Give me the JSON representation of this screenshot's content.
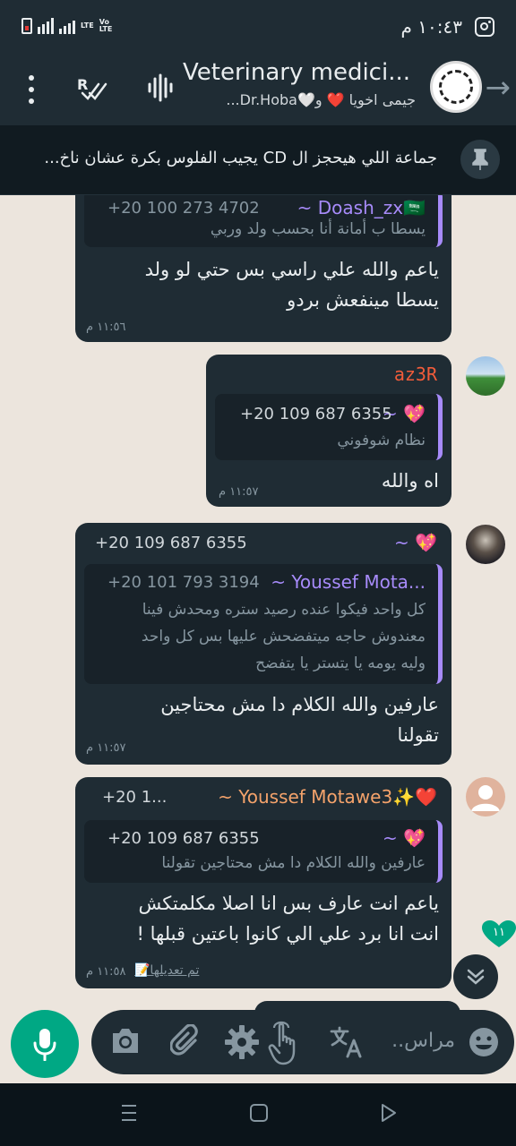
{
  "status_bar": {
    "network_label": "LTE",
    "volte_label": "Vo LTE",
    "time": "١٠:٤٣ م"
  },
  "header": {
    "title": "Veterinary medici...",
    "members": "جيمى اخويا ❤️ و🤍Dr.Hoba..."
  },
  "pinned": {
    "text": "جماعة اللي هيحجز ال CD يجيب الفلوس بكرة عشان ناخ..."
  },
  "messages": [
    {
      "quote": {
        "name": "~ Doash_zx🇸🇦",
        "phone": "+20 100 273 4702",
        "text": "يسطا ب أمانة أنا بحسب ولد وربي"
      },
      "lines": [
        "ياعم والله علي راسي بس حتي لو ولد",
        "يسطا مينفعش بردو"
      ],
      "time": "١١:٥٦ م"
    },
    {
      "sender": "az3R",
      "quote": {
        "name": "~ 💖",
        "phone": "+20 109 687 6355",
        "text": "نظام شوفوني"
      },
      "lines": [
        "اه والله"
      ],
      "time": "١١:٥٧ م"
    },
    {
      "sender": "~ 💖",
      "sender_phone": "+20 109 687 6355",
      "quote": {
        "name": "~ Youssef Mota...",
        "phone": "+20 101 793 3194",
        "lines": [
          "كل واحد فيكوا عنده رصيد ستره ومحدش فينا",
          "معندوش حاجه ميتفضحش عليها بس كل واحد",
          "وليه يومه يا يتستر يا يتفضح"
        ]
      },
      "lines": [
        "عارفين والله الكلام دا مش محتاجين",
        "تقولنا"
      ],
      "time": "١١:٥٧ م"
    },
    {
      "sender": "~ Youssef Motawe3✨❤️",
      "sender_phone": "+20 1...",
      "quote": {
        "name": "~ 💖",
        "phone": "+20 109 687 6355",
        "text": "عارفين والله الكلام دا مش محتاجين تقولنا"
      },
      "lines": [
        "ياعم انت عارف بس انا اصلا مكلمتكش",
        "انت انا برد علي الي كانوا باعتين قبلها !"
      ],
      "edited": "تم تعديلها📝",
      "time": "١١:٥٨ م"
    }
  ],
  "unread_count": "١١",
  "composer": {
    "placeholder": "مراس.."
  },
  "colors": {
    "accent": "#00a884",
    "bubble": "#1f2c34",
    "quote_bar": "#a78bfa",
    "sender_az3r": "#f15c3a",
    "sender_youssef": "#f5a36b"
  }
}
